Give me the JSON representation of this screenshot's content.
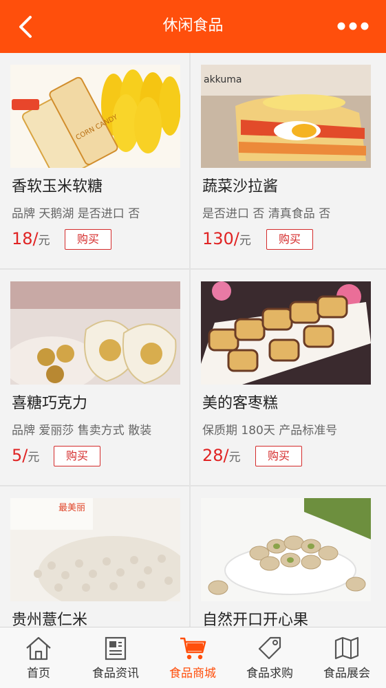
{
  "header": {
    "title": "休闲食品",
    "back_icon": "back-arrow-icon",
    "more_icon": "more-dots-icon",
    "color": "#ff4f0c"
  },
  "products": [
    {
      "name": "香软玉米软糖",
      "spec": "品牌 天鹅湖 是否进口 否",
      "price": "18/",
      "unit": "元",
      "buy": "购买",
      "image_text": "CORN CANDY"
    },
    {
      "name": "蔬菜沙拉酱",
      "spec": "是否进口 否 清真食品 否",
      "price": "130/",
      "unit": "元",
      "buy": "购买",
      "image_text": "akkuma"
    },
    {
      "name": "喜糖巧克力",
      "spec": "品牌 爱丽莎 售卖方式 散装",
      "price": "5/",
      "unit": "元",
      "buy": "购买"
    },
    {
      "name": "美的客枣糕",
      "spec": "保质期 180天 产品标准号",
      "price": "28/",
      "unit": "元",
      "buy": "购买"
    },
    {
      "name": "贵州薏仁米",
      "image_text": "最美丽"
    },
    {
      "name": "自然开口开心果"
    }
  ],
  "tabs": [
    {
      "label": "首页",
      "icon": "home-icon"
    },
    {
      "label": "食品资讯",
      "icon": "news-icon"
    },
    {
      "label": "食品商城",
      "icon": "cart-icon",
      "active": true
    },
    {
      "label": "食品求购",
      "icon": "tag-icon"
    },
    {
      "label": "食品展会",
      "icon": "map-icon"
    }
  ]
}
